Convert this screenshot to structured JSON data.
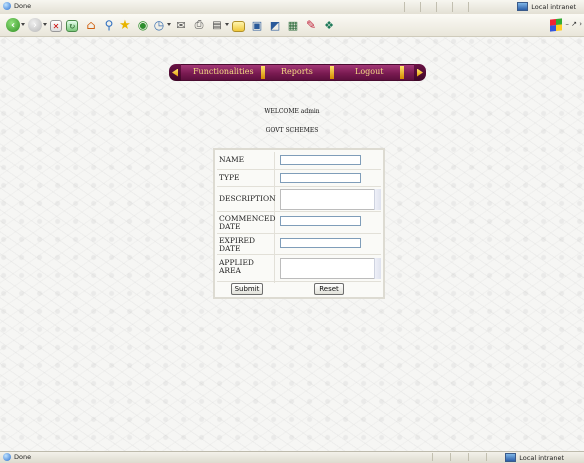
{
  "browser": {
    "status_text": "Done",
    "zone_text": "Local intranet",
    "window_controls": "– ↗ ›"
  },
  "nav": {
    "items": [
      "Functionalities",
      "Reports",
      "Logout"
    ]
  },
  "page": {
    "welcome": "WELCOME admin",
    "subtitle": "GOVT SCHEMES"
  },
  "form": {
    "fields": [
      {
        "label": "NAME",
        "value": ""
      },
      {
        "label": "TYPE",
        "value": ""
      },
      {
        "label": "DESCRIPTION",
        "value": ""
      },
      {
        "label": "COMMENCED DATE",
        "value": ""
      },
      {
        "label": "EXPIRED DATE",
        "value": ""
      },
      {
        "label": "APPLIED AREA",
        "value": ""
      }
    ],
    "submit_label": "Submit",
    "reset_label": "Reset"
  }
}
